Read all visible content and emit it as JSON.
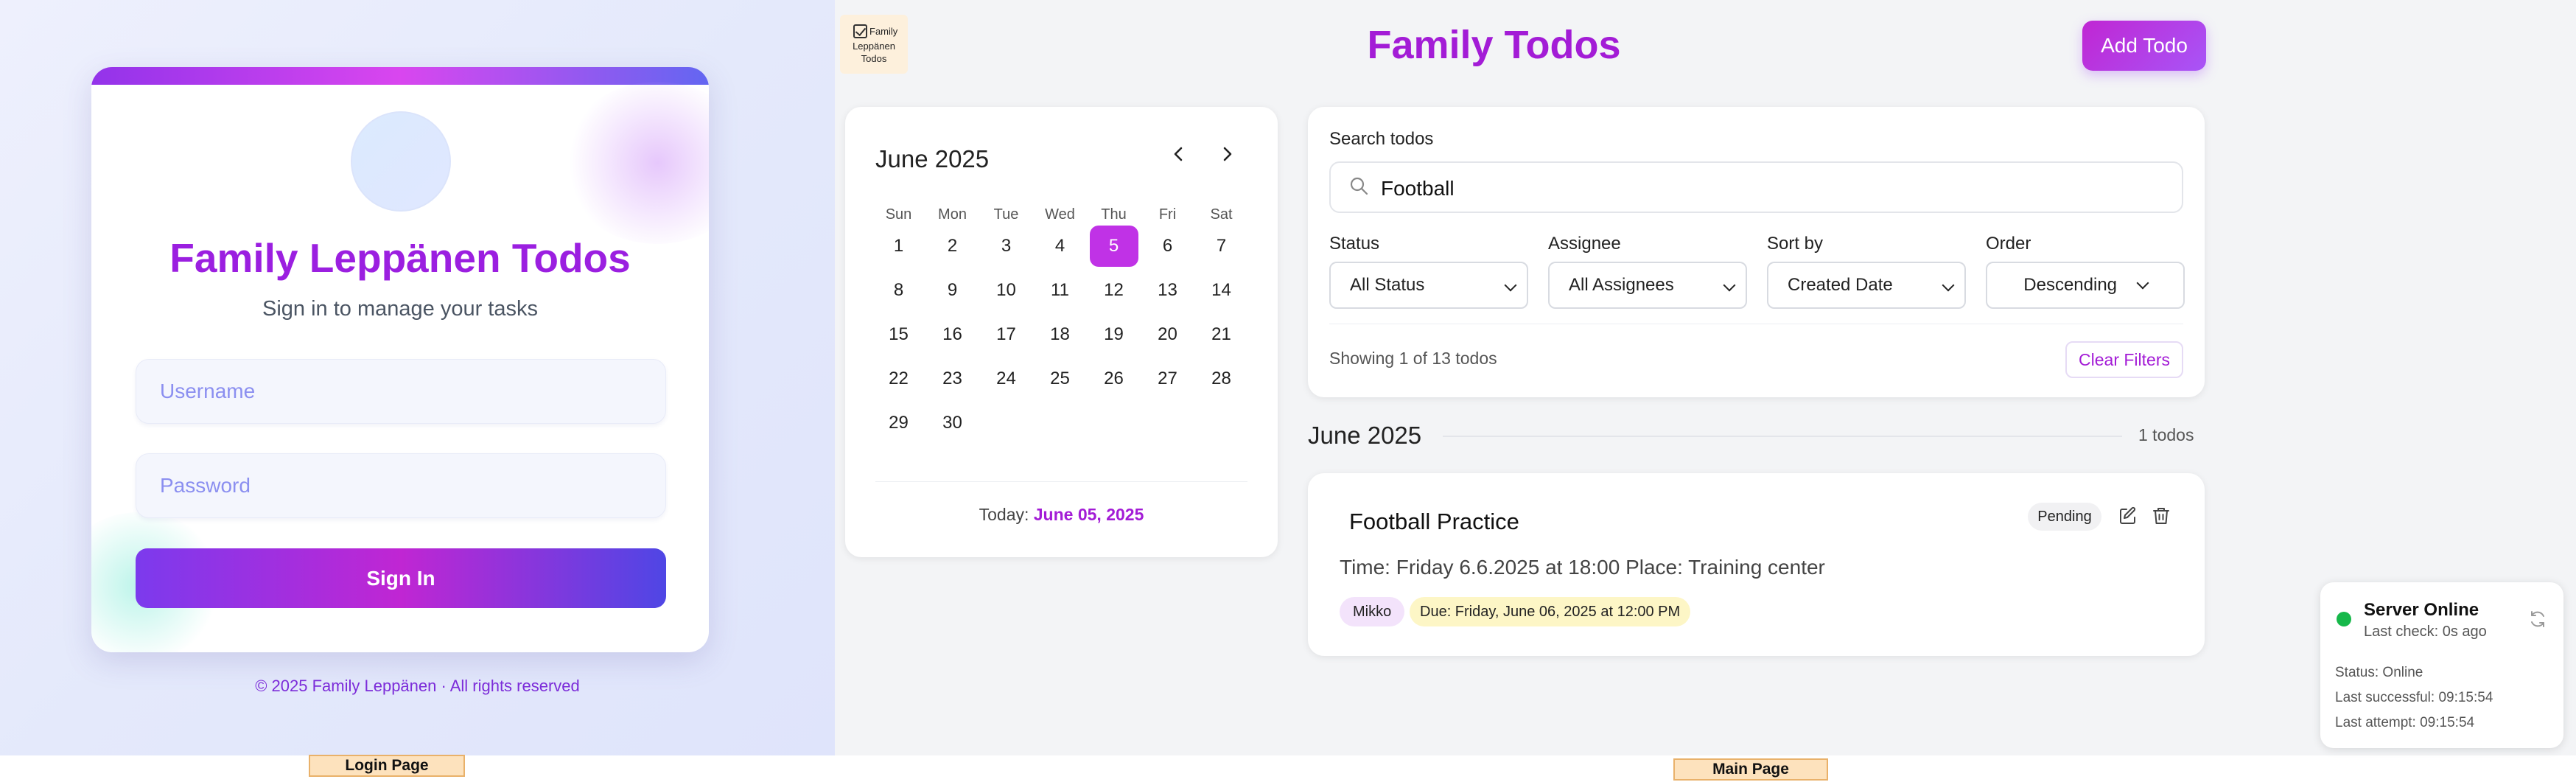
{
  "login": {
    "title": "Family Leppänen Todos",
    "subtitle": "Sign in to manage your tasks",
    "username_placeholder": "Username",
    "password_placeholder": "Password",
    "sign_in_label": "Sign In",
    "footer": "© 2025 Family Leppänen · All rights reserved",
    "page_tag": "Login Page"
  },
  "main": {
    "page_tag": "Main Page",
    "logo": {
      "line1": "Family",
      "line2": "Leppänen",
      "line3": "Todos"
    },
    "title": "Family Todos",
    "add_todo_label": "Add Todo",
    "calendar": {
      "month_label": "June 2025",
      "weekdays": [
        "Sun",
        "Mon",
        "Tue",
        "Wed",
        "Thu",
        "Fri",
        "Sat"
      ],
      "start_weekday": 0,
      "days_in_month": 30,
      "selected_day": 5,
      "today_prefix": "Today:",
      "today_date": "June 05, 2025"
    },
    "filters": {
      "search_label": "Search todos",
      "search_value": "Football",
      "status_label": "Status",
      "status_value": "All Status",
      "assignee_label": "Assignee",
      "assignee_value": "All Assignees",
      "sort_label": "Sort by",
      "sort_value": "Created Date",
      "order_label": "Order",
      "order_value": "Descending",
      "showing_text": "Showing 1 of 13 todos",
      "clear_label": "Clear Filters"
    },
    "group": {
      "title": "June 2025",
      "count": "1 todos"
    },
    "todo": {
      "title": "Football Practice",
      "status": "Pending",
      "description": "Time: Friday 6.6.2025 at 18:00 Place: Training center",
      "assignee": "Mikko",
      "due": "Due: Friday, June 06, 2025 at 12:00 PM"
    },
    "server_status": {
      "title": "Server Online",
      "last_check": "Last check: 0s ago",
      "status_line": "Status: Online",
      "last_successful": "Last successful: 09:15:54",
      "last_attempt": "Last attempt: 09:15:54",
      "dot_color": "#16b84a"
    }
  },
  "colors": {
    "accent": "#a31cd6",
    "today_bg": "#c032e6"
  }
}
